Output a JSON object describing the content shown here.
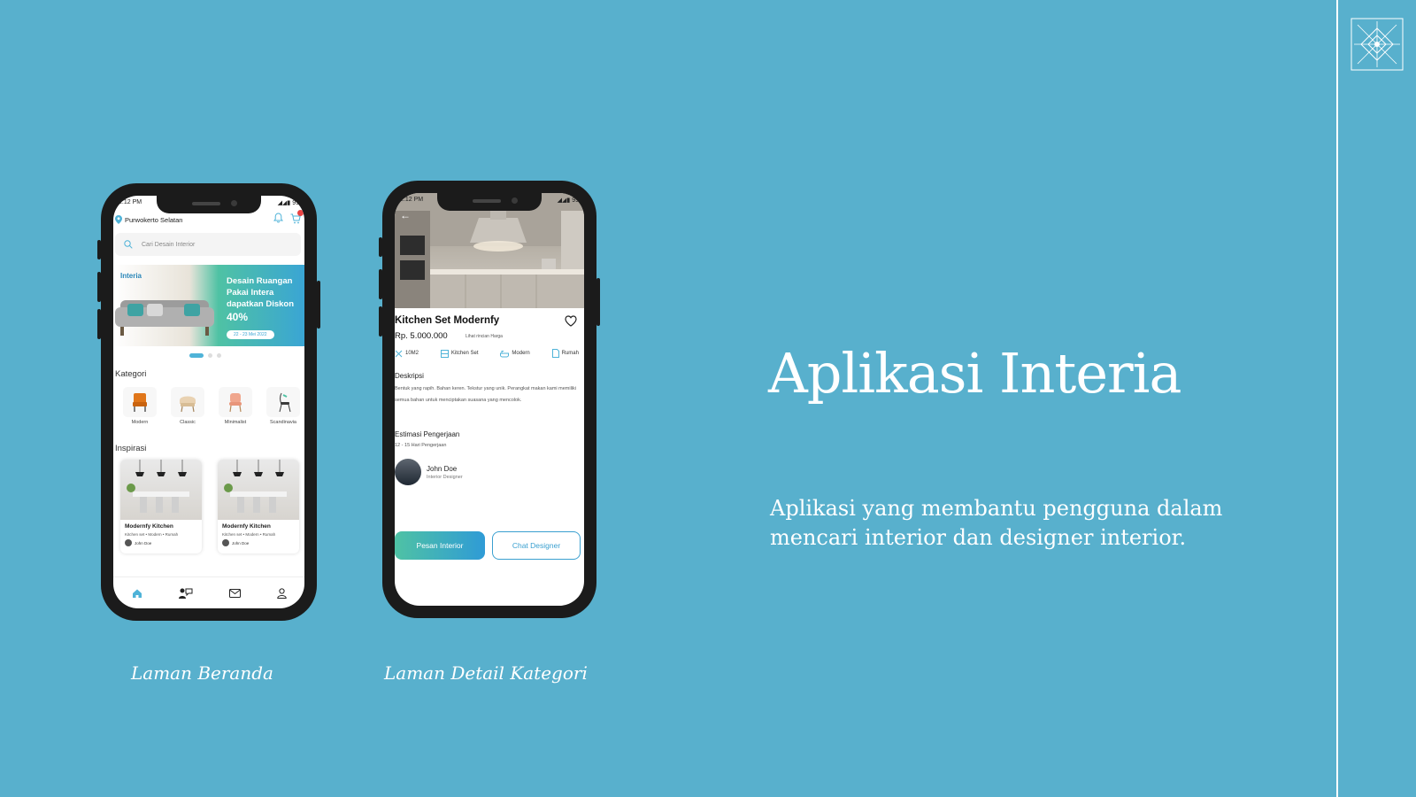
{
  "slide": {
    "title": "Aplikasi Interia",
    "subtitle": "Aplikasi yang membantu pengguna dalam mencari interior dan designer interior.",
    "caption_left": "Laman Beranda",
    "caption_right": "Laman Detail Kategori",
    "colors": {
      "background": "#58b0cd",
      "accent": "#3aa5d4",
      "accent_green": "#4fc2a4"
    }
  },
  "home": {
    "status_time": "2:12 PM",
    "status_right": "◢◢▮ 99",
    "location": "Purwokerto Selatan",
    "search_placeholder": "Cari Desain Interior",
    "banner": {
      "brand": "Interia",
      "headline": "Desain Ruangan Pakai Intera dapatkan Diskon",
      "discount": "40%",
      "date": "22 - 23 Mei 2022"
    },
    "category_title": "Kategori",
    "categories": [
      "Modern",
      "Classic",
      "Minimalist",
      "Scandinavia"
    ],
    "inspiration_title": "Inspirasi",
    "cards": [
      {
        "title": "Modernfy Kitchen",
        "subtitle": "Kitchen set • Modern • Rumah",
        "user": "John Doe"
      },
      {
        "title": "Modernfy Kitchen",
        "subtitle": "Kitchen set • Modern • Rumah",
        "user": "John Doe"
      }
    ],
    "nav": [
      "home-icon",
      "designer-chat-icon",
      "mail-icon",
      "profile-icon"
    ]
  },
  "detail": {
    "status_time": "2:12 PM",
    "status_right": "◢◢▮ 99",
    "back": "←",
    "title": "Kitchen Set Modernfy",
    "price": "Rp. 5.000.000",
    "see_price": "Lihat rincian Harga",
    "tags": [
      "10M2",
      "Kitchen Set",
      "Modern",
      "Rumah"
    ],
    "desc_title": "Deskripsi",
    "desc": "Bentuk yang rapih. Bahan keren. Tekstur yang unik. Perangkat makan kami memiliki semua bahan untuk menciptakan suasana yang mencolok.",
    "est_title": "Estimasi Pengerjaan",
    "est": "12 - 15 Hari Pengerjaan",
    "designer_name": "John Doe",
    "designer_role": "Interior Designer",
    "order_button": "Pesan Interior",
    "chat_button": "Chat Designer"
  }
}
